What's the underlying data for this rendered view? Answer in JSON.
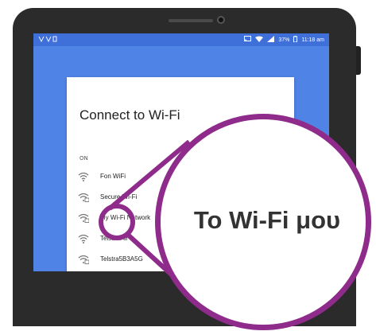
{
  "status_bar": {
    "battery": "37%",
    "time": "11:18 am"
  },
  "dialog": {
    "title": "Connect to Wi-Fi",
    "wifi_state": "ON",
    "networks": [
      {
        "name": "Fon WiFi",
        "secured": false
      },
      {
        "name": "Secure Wi-Fi",
        "secured": true
      },
      {
        "name": "My Wi-Fi Network",
        "secured": true
      },
      {
        "name": "Telstra Air",
        "secured": false
      },
      {
        "name": "Telstra5B3A5G",
        "secured": true
      }
    ]
  },
  "magnifier": {
    "text": "Το Wi-Fi μου"
  },
  "colors": {
    "screen_background": "#5083e6",
    "status_bar": "#3f6fd8",
    "highlight": "#8e2b8b",
    "device": "#2b2b2b"
  },
  "icons": [
    "wifi-icon",
    "wifi-lock-icon",
    "cast-icon",
    "signal-icon",
    "battery-icon"
  ]
}
